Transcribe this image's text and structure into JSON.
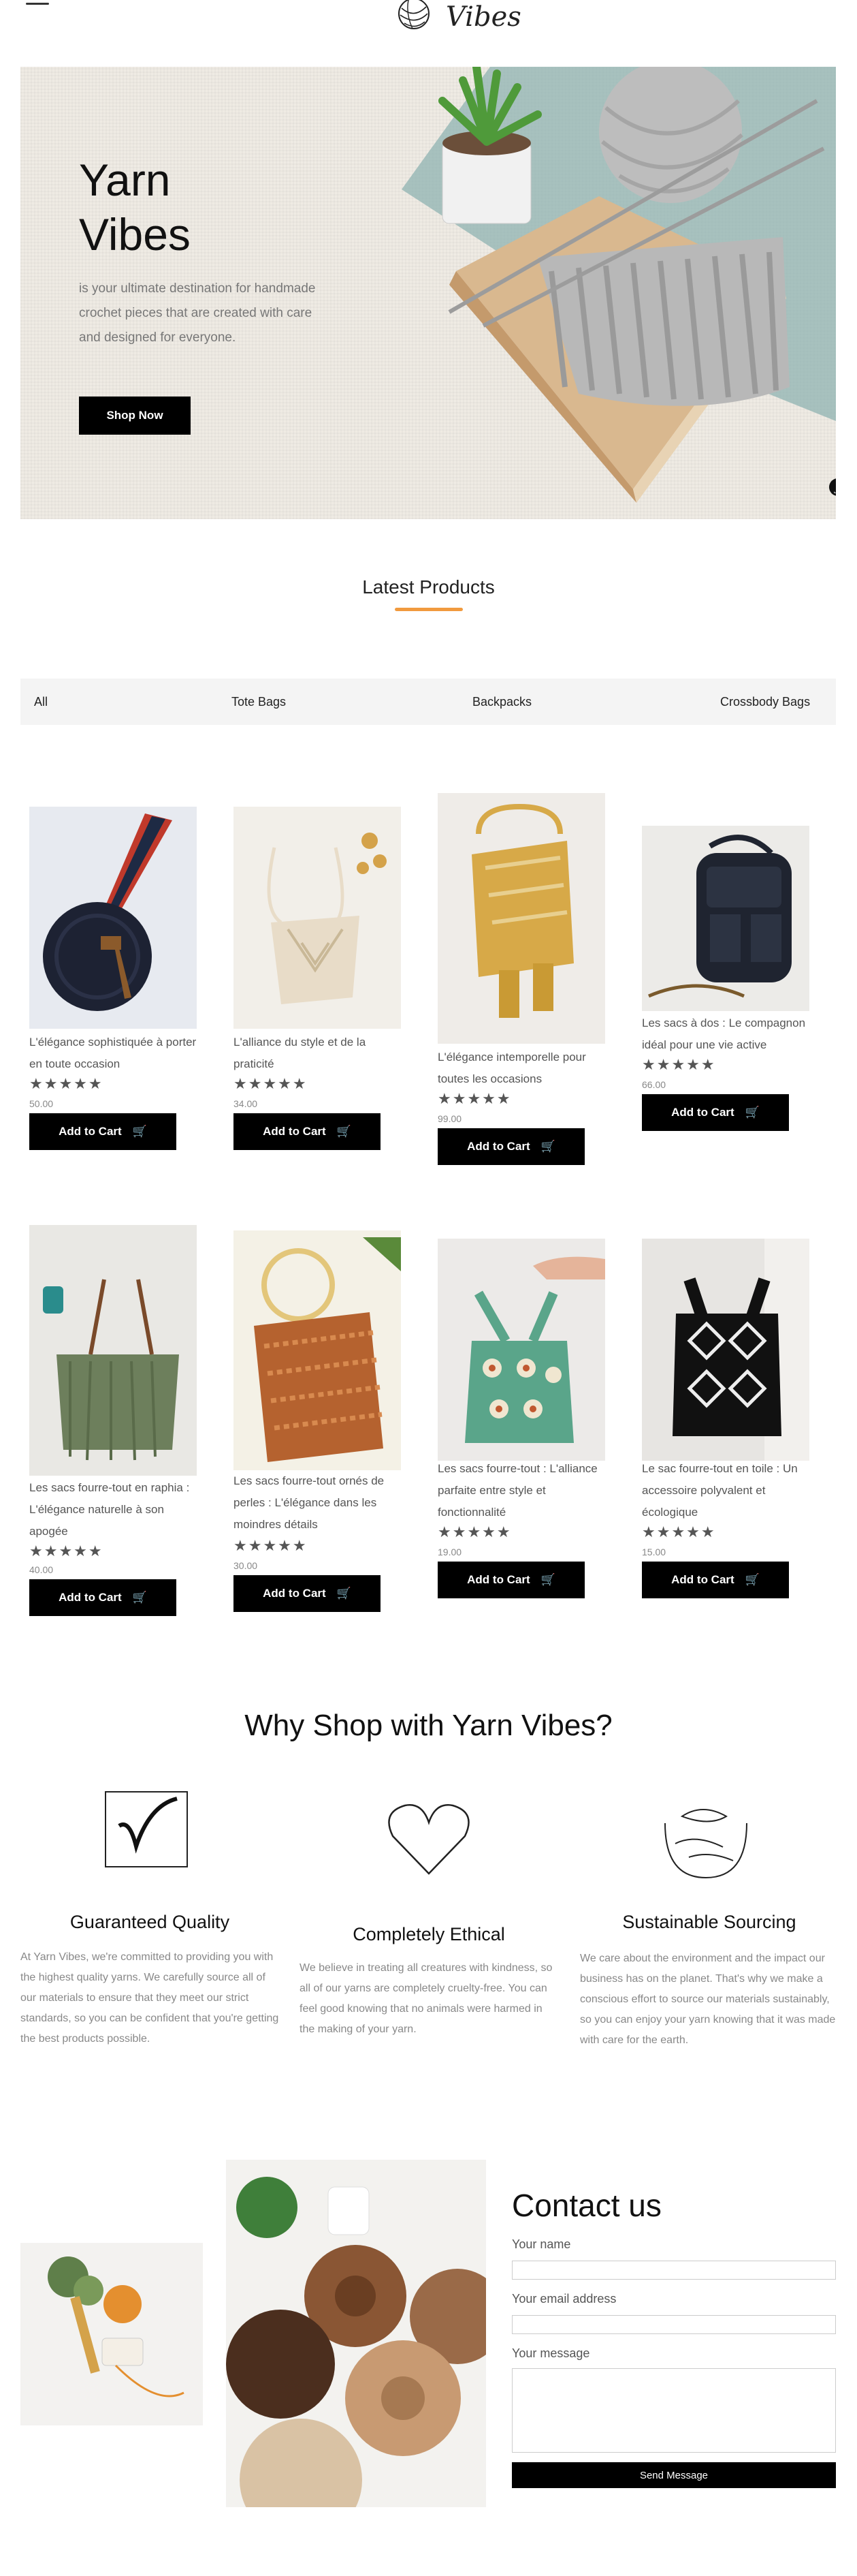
{
  "header": {
    "logo_text": "Vibes"
  },
  "hero": {
    "title_line1": "Yarn",
    "title_line2": "Vibes",
    "description": "is your ultimate destination for handmade crochet pieces that are created with care and designed for everyone.",
    "cta": "Shop Now",
    "badge": "ƒ"
  },
  "latest": {
    "title": "Latest Products",
    "filters": [
      "All",
      "Tote Bags",
      "Backpacks",
      "Crossbody Bags"
    ],
    "cart_label": "Add to Cart",
    "stars": "★★★★★",
    "products": [
      {
        "name": "L'élégance sophistiquée à porter en toute occasion",
        "price": "50.00"
      },
      {
        "name": "L'alliance du style et de la praticité",
        "price": "34.00"
      },
      {
        "name": "L'élégance intemporelle pour toutes les occasions",
        "price": "99.00"
      },
      {
        "name": "Les sacs à dos : Le compagnon idéal pour une vie active",
        "price": "66.00"
      },
      {
        "name": "Les sacs fourre-tout en raphia : L'élégance naturelle à son apogée",
        "price": "40.00"
      },
      {
        "name": "Les sacs fourre-tout ornés de perles : L'élégance dans les moindres détails",
        "price": "30.00"
      },
      {
        "name": "Les sacs fourre-tout : L'alliance parfaite entre style et fonctionnalité",
        "price": "19.00"
      },
      {
        "name": "Le sac fourre-tout en toile : Un accessoire polyvalent et écologique",
        "price": "15.00"
      }
    ]
  },
  "why": {
    "title": "Why Shop with Yarn Vibes?",
    "features": [
      {
        "title": "Guaranteed Quality",
        "text": "At Yarn Vibes, we're committed to providing you with the highest quality yarns. We carefully source all of our materials to ensure that they meet our strict standards, so you can be confident that you're getting the best products possible."
      },
      {
        "title": "Completely Ethical",
        "text": "We believe in treating all creatures with kindness, so all of our yarns are completely cruelty-free. You can feel good knowing that no animals were harmed in the making of your yarn."
      },
      {
        "title": "Sustainable Sourcing",
        "text": "We care about the environment and the impact our business has on the planet. That's why we make a conscious effort to source our materials sustainably, so you can enjoy your yarn knowing that it was made with care for the earth."
      }
    ]
  },
  "contact": {
    "title": "Contact us",
    "name_label": "Your name",
    "email_label": "Your email address",
    "message_label": "Your message",
    "submit": "Send Message"
  }
}
